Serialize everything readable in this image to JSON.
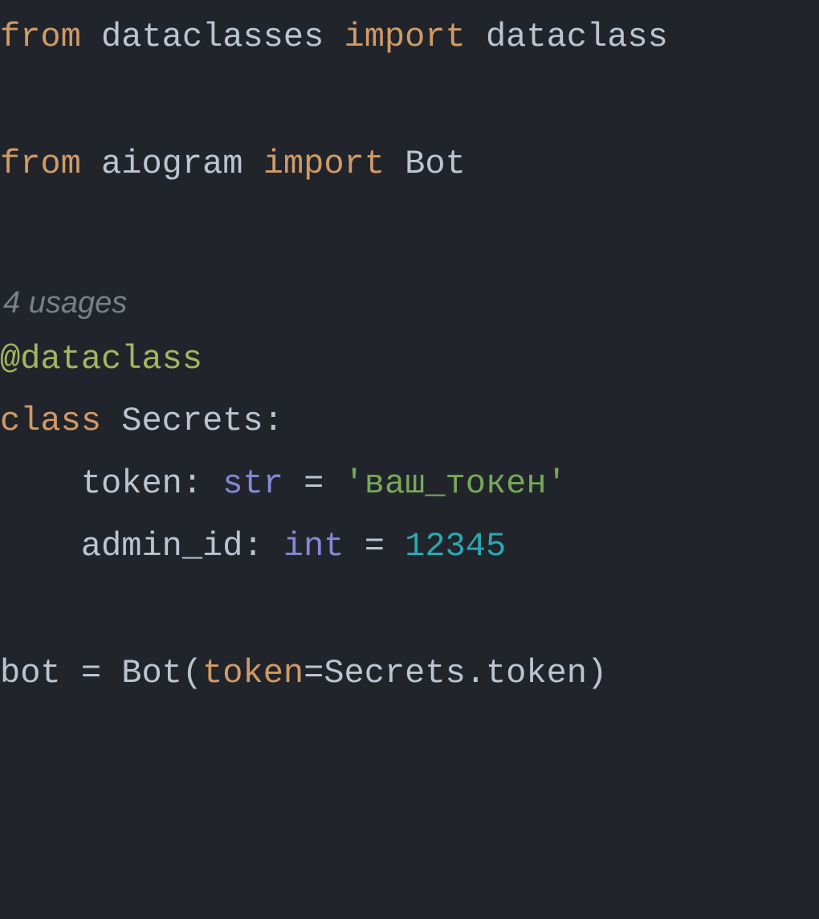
{
  "lines": {
    "l1": {
      "from": "from",
      "module1": "dataclasses",
      "import": "import",
      "name1": "dataclass"
    },
    "l2": {
      "from": "from",
      "module2": "aiogram",
      "import": "import",
      "name2": "Bot"
    },
    "hint": "4 usages",
    "decorator": "@dataclass",
    "l_class": {
      "class": "class",
      "name": "Secrets",
      "colon": ":"
    },
    "l_token": {
      "indent": "    ",
      "field": "token",
      "colon_sp": ": ",
      "type": "str",
      "eq": " = ",
      "value": "'ваш_токен'"
    },
    "l_admin": {
      "indent": "    ",
      "field": "admin_id",
      "colon_sp": ": ",
      "type": "int",
      "eq": " = ",
      "value": "12345"
    },
    "l_bot": {
      "var": "bot",
      "eq": " = ",
      "cls": "Bot",
      "lp": "(",
      "param": "token",
      "assign": "=",
      "expr": "Secrets.token",
      "rp": ")"
    }
  }
}
